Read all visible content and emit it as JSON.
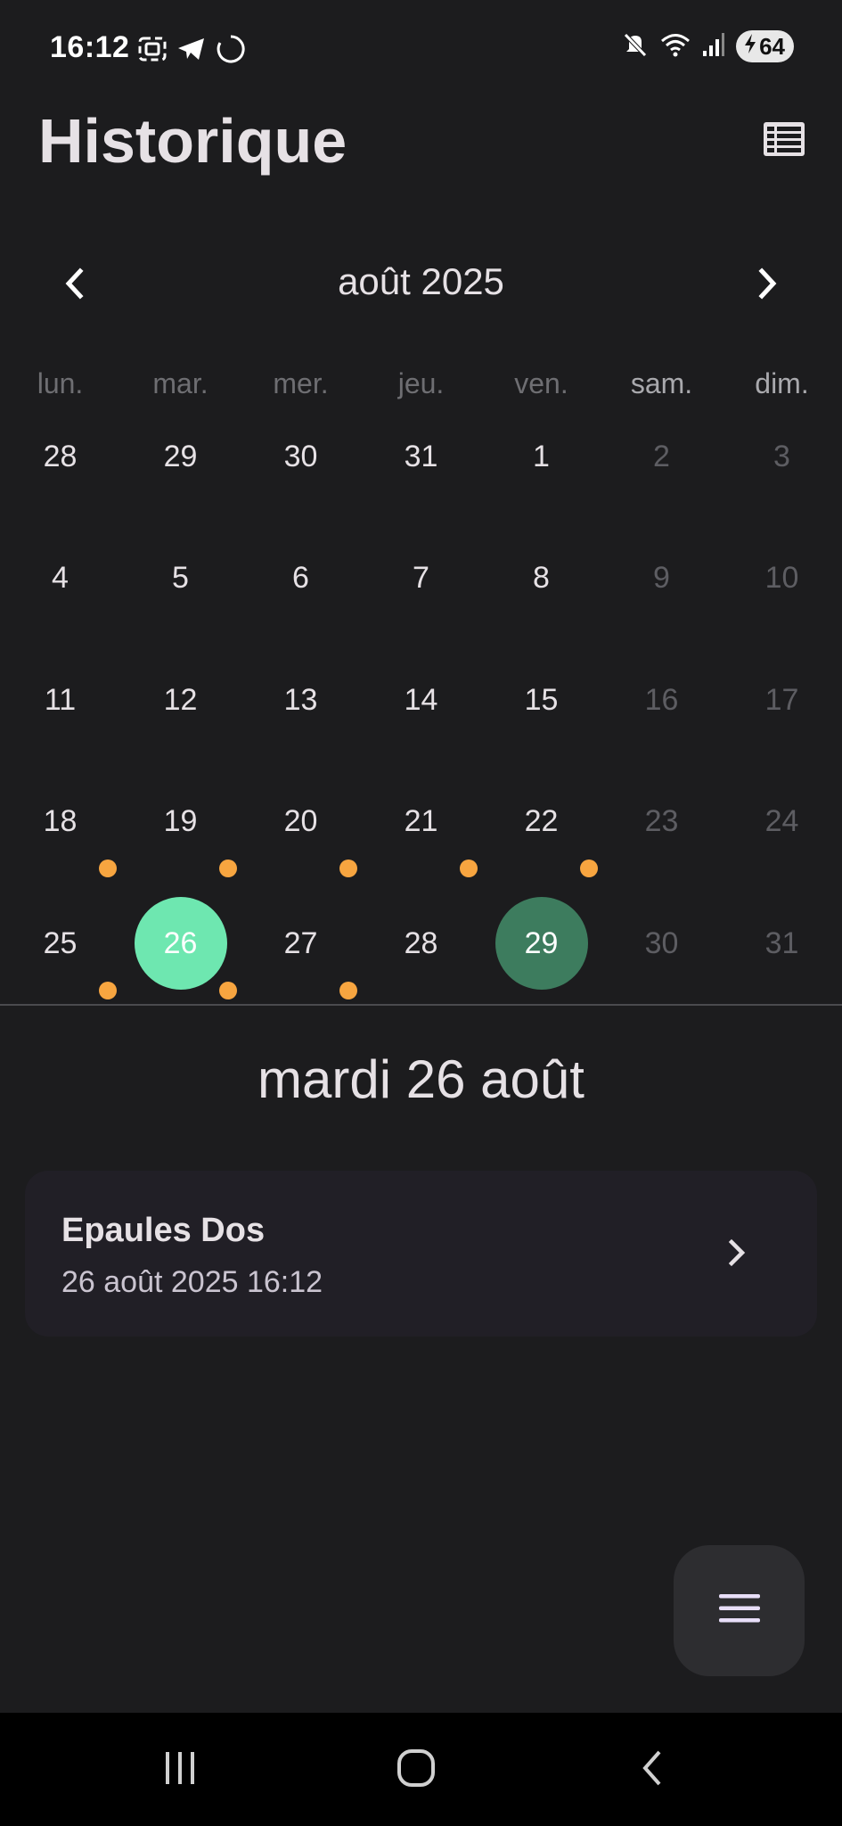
{
  "status_bar": {
    "time": "16:12",
    "battery": "64",
    "icons_left": [
      "screenshot-icon",
      "telegram-icon",
      "loading-icon"
    ],
    "icons_right": [
      "mute-icon",
      "wifi-icon",
      "signal-icon",
      "battery-charging-icon"
    ]
  },
  "header": {
    "title": "Historique",
    "list_view_icon": "list-view-icon"
  },
  "calendar": {
    "month_label": "août 2025",
    "weekdays": [
      "lun.",
      "mar.",
      "mer.",
      "jeu.",
      "ven.",
      "sam.",
      "dim."
    ],
    "weeks": [
      [
        "28",
        "29",
        "30",
        "31",
        "1",
        "2",
        "3"
      ],
      [
        "4",
        "5",
        "6",
        "7",
        "8",
        "9",
        "10"
      ],
      [
        "11",
        "12",
        "13",
        "14",
        "15",
        "16",
        "17"
      ],
      [
        "18",
        "19",
        "20",
        "21",
        "22",
        "23",
        "24"
      ],
      [
        "25",
        "26",
        "27",
        "28",
        "29",
        "30",
        "31"
      ]
    ],
    "selected_day": "26",
    "today": "29",
    "event_marker_color": "#f7a540",
    "selected_color": "#6ee7b0",
    "today_color": "#3d7c5e"
  },
  "selected_date_label": "mardi 26 août",
  "sessions": [
    {
      "title": "Epaules Dos",
      "datetime": "26 août 2025 16:12"
    }
  ],
  "fab": {
    "icon": "menu-icon"
  },
  "system_nav": {
    "recent": "recent-apps-icon",
    "home": "home-icon",
    "back": "back-icon"
  }
}
